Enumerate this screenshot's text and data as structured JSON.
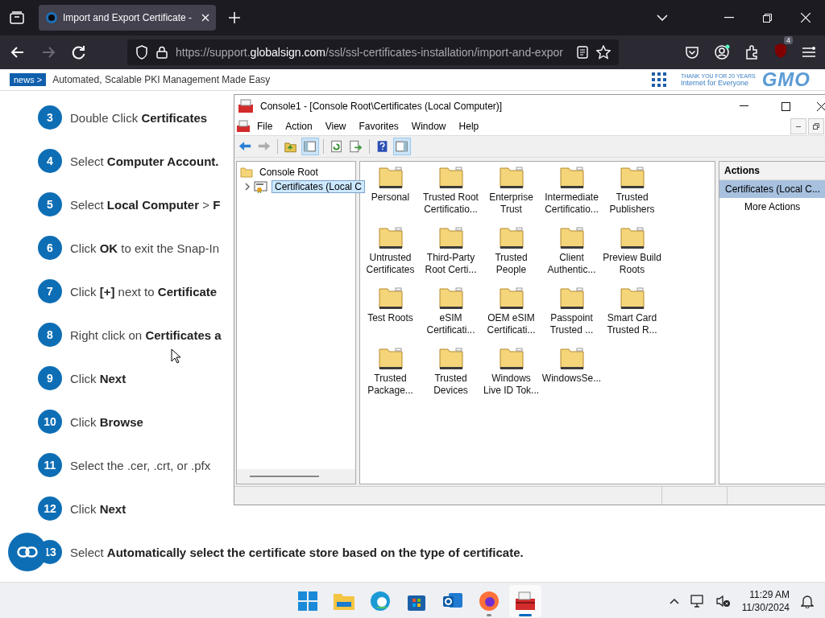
{
  "browser": {
    "tabs": [
      {
        "title": "Import and Export Certificate -",
        "selected": true
      }
    ],
    "nav_buttons": [
      {
        "disabled": false
      },
      {
        "disabled": true
      },
      {
        "disabled": false
      }
    ],
    "url": "https://support.**globalsign.com**/ssl/ssl-certificates-installation/import-and-expor",
    "extension_badge": "4"
  },
  "news_bar": {
    "tag": "news >",
    "headline": "Automated, Scalable PKI Management Made Easy",
    "tagline_top": "THANK YOU FOR 20 YEARS",
    "tagline_bottom": "Internet for Everyone",
    "logo": "GMO"
  },
  "steps": [
    {
      "number": "3",
      "text": "Double Click **Certificates**"
    },
    {
      "number": "4",
      "text": "Select **Computer Account.**"
    },
    {
      "number": "5",
      "text": "Select **Local Computer** > **F**"
    },
    {
      "number": "6",
      "text": "Click **OK** to exit the Snap-In"
    },
    {
      "number": "7",
      "text": "Click **[+]** next to **Certificate**"
    },
    {
      "number": "8",
      "text": "Right click on **Certificates a**"
    },
    {
      "number": "9",
      "text": "Click **Next**"
    },
    {
      "number": "10",
      "text": "Click **Browse**"
    },
    {
      "number": "11",
      "text": "Select the .cer, .crt, or .pfx"
    },
    {
      "number": "12",
      "text": "Click **Next**"
    },
    {
      "number": "13",
      "text": "Select **Automatically select the certificate store based on the type of certificate.**"
    }
  ],
  "mmc": {
    "title": "Console1 - [Console Root\\Certificates (Local Computer)]",
    "menu": [
      "File",
      "Action",
      "View",
      "Favorites",
      "Window",
      "Help"
    ],
    "toolbar": [
      {
        "on": false,
        "disabled": false
      },
      {
        "on": false,
        "disabled": true
      },
      {
        "on": false,
        "disabled": false
      },
      {
        "on": true,
        "disabled": false
      },
      {
        "on": false,
        "disabled": false
      },
      {
        "on": false,
        "disabled": false
      },
      {
        "on": false,
        "disabled": false
      },
      {
        "on": true,
        "disabled": false
      }
    ],
    "tree": [
      {
        "label": "Console Root",
        "selected": false,
        "children": [
          {
            "label": "Certificates (Local C",
            "selected": true,
            "expanded": false
          }
        ]
      }
    ],
    "stores": [
      {
        "label": "Personal"
      },
      {
        "label": "Trusted Root\nCertificatio..."
      },
      {
        "label": "Enterprise\nTrust"
      },
      {
        "label": "Intermediate\nCertificatio..."
      },
      {
        "label": "Trusted\nPublishers"
      },
      {
        "label": "Untrusted\nCertificates"
      },
      {
        "label": "Third-Party\nRoot Certi..."
      },
      {
        "label": "Trusted\nPeople"
      },
      {
        "label": "Client\nAuthentic..."
      },
      {
        "label": "Preview Build\nRoots"
      },
      {
        "label": "Test Roots"
      },
      {
        "label": "eSIM\nCertificati..."
      },
      {
        "label": "OEM eSIM\nCertificati..."
      },
      {
        "label": "Passpoint\nTrusted ..."
      },
      {
        "label": "Smart Card\nTrusted R..."
      },
      {
        "label": "Trusted\nPackage..."
      },
      {
        "label": "Trusted\nDevices"
      },
      {
        "label": "Windows\nLive ID Tok..."
      },
      {
        "label": "WindowsSe..."
      }
    ],
    "actions": {
      "header": "Actions",
      "items": [
        {
          "label": "Certificates (Local C...",
          "selected": true,
          "kind": "group"
        },
        {
          "label": "More Actions",
          "selected": false,
          "kind": "action"
        }
      ]
    }
  },
  "taskbar": {
    "apps": [
      {
        "running": false,
        "active": false
      },
      {
        "running": false,
        "active": false
      },
      {
        "running": false,
        "active": false
      },
      {
        "running": false,
        "active": false
      },
      {
        "running": false,
        "active": false
      },
      {
        "running": true,
        "active": false
      },
      {
        "running": true,
        "active": true
      }
    ],
    "time": "11:29 AM",
    "date": "11/30/2024"
  }
}
